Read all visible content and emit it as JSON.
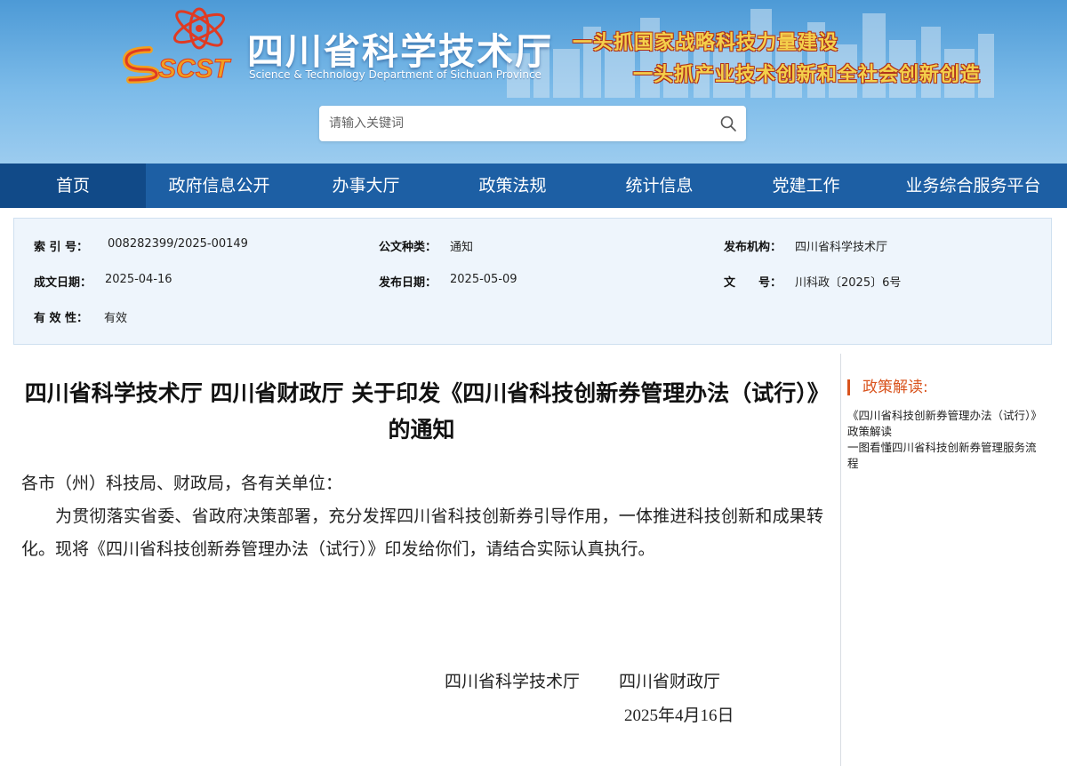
{
  "header": {
    "logo_text": "SCST",
    "site_title": "四川省科学技术厅",
    "site_subtitle": "Science & Technology Department of Sichuan Province",
    "slogan_1": "一头抓国家战略科技力量建设",
    "slogan_2": "一头抓产业技术创新和全社会创新创造",
    "search_placeholder": "请输入关键词"
  },
  "nav": {
    "items": [
      {
        "label": "首页",
        "active": true
      },
      {
        "label": "政府信息公开"
      },
      {
        "label": "办事大厅"
      },
      {
        "label": "政策法规"
      },
      {
        "label": "统计信息"
      },
      {
        "label": "党建工作"
      },
      {
        "label": "业务综合服务平台"
      }
    ]
  },
  "info": {
    "index_no_label": "索 引 号：",
    "index_no": "008282399/2025-00149",
    "doc_type_label": "公文种类：",
    "doc_type": "通知",
    "issuer_label": "发布机构：",
    "issuer": "四川省科学技术厅",
    "written_date_label": "成文日期：",
    "written_date": "2025-04-16",
    "publish_date_label": "发布日期：",
    "publish_date": "2025-05-09",
    "doc_no_label": "文　　号：",
    "doc_no": "川科政〔2025〕6号",
    "validity_label": "有 效 性：",
    "validity": "有效"
  },
  "article": {
    "title": "四川省科学技术厅 四川省财政厅 关于印发《四川省科技创新券管理办法（试行）》的通知",
    "salutation": "各市（州）科技局、财政局，各有关单位：",
    "body": "为贯彻落实省委、省政府决策部署，充分发挥四川省科技创新券引导作用，一体推进科技创新和成果转化。现将《四川省科技创新券管理办法（试行）》印发给你们，请结合实际认真执行。",
    "sign_org_1": "四川省科学技术厅",
    "sign_org_2": "四川省财政厅",
    "sign_date": "2025年4月16日"
  },
  "sidebar": {
    "heading": "政策解读:",
    "links": [
      "《四川省科技创新券管理办法（试行）》政策解读",
      "一图看懂四川省科技创新券管理服务流程"
    ]
  },
  "colors": {
    "nav_bg": "#1d5fa4",
    "nav_active_bg": "#114a88",
    "accent_orange": "#d9541e",
    "info_panel_bg": "#eef5fc"
  }
}
